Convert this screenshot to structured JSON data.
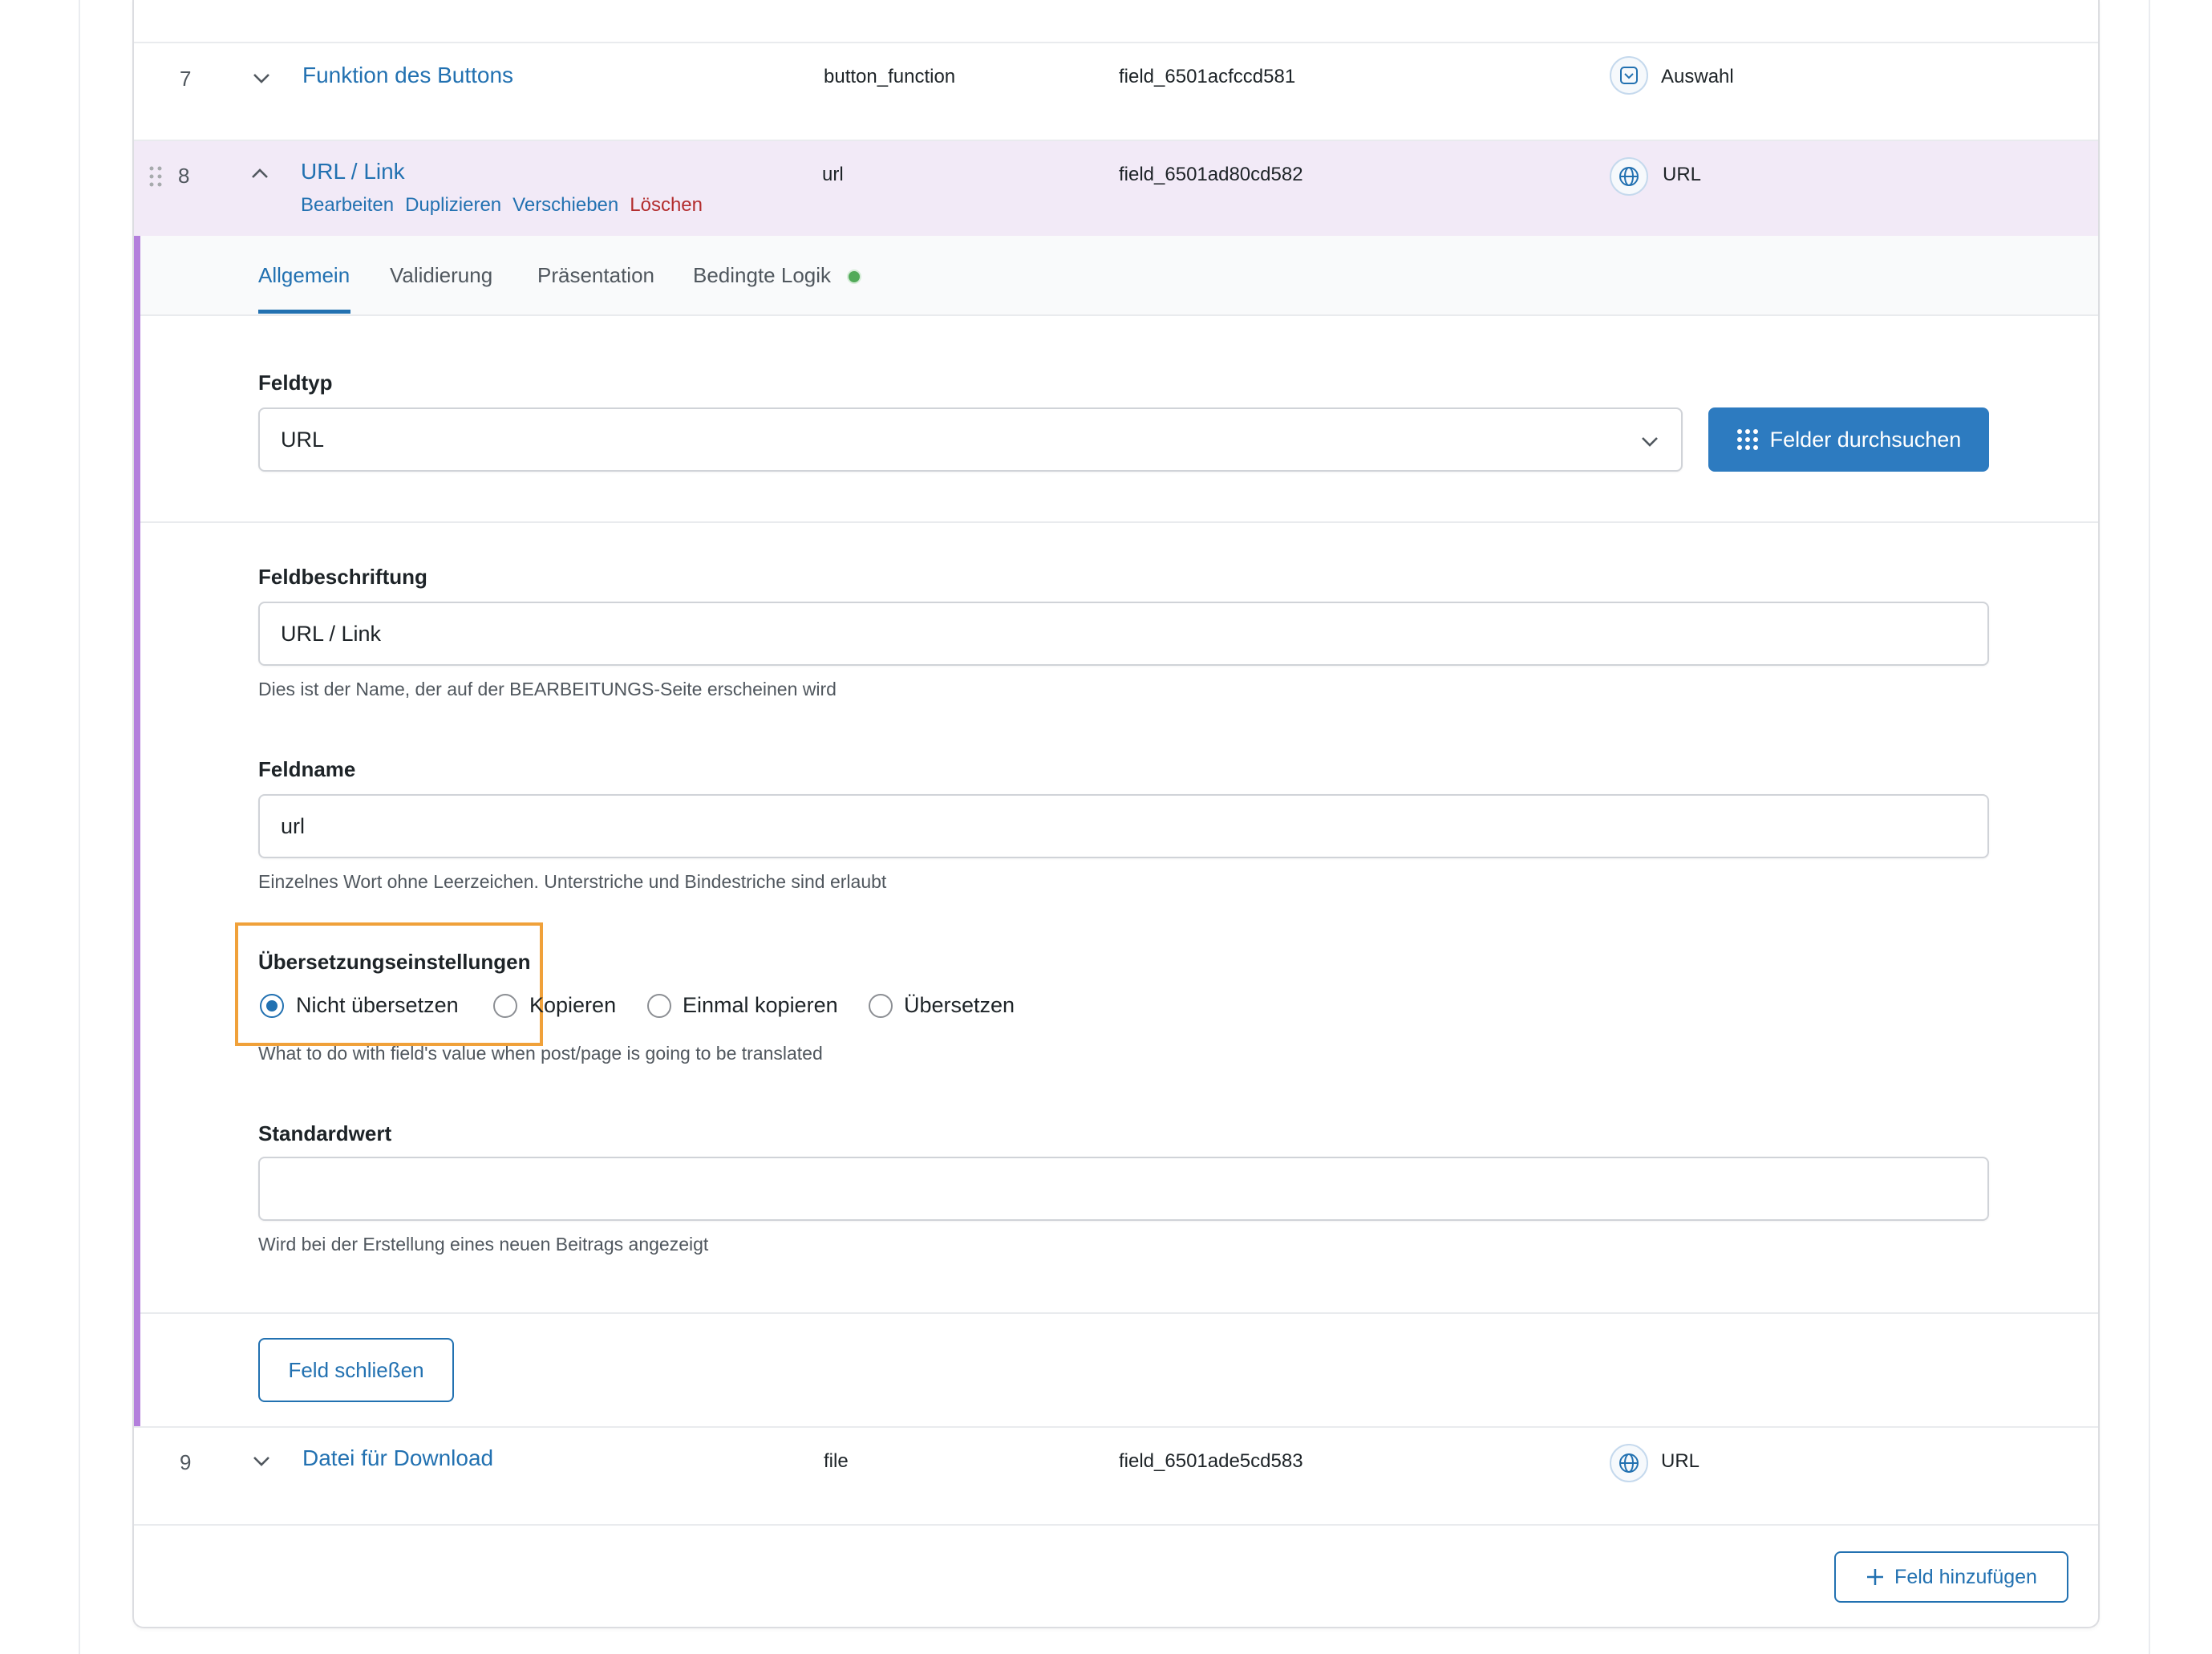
{
  "rows": [
    {
      "num": "7",
      "title": "Funktion des Buttons",
      "name": "button_function",
      "key": "field_6501acfccd581",
      "type": "Auswahl",
      "type_icon": "select-icon"
    },
    {
      "num": "8",
      "title": "URL / Link",
      "name": "url",
      "key": "field_6501ad80cd582",
      "type": "URL",
      "type_icon": "globe-icon"
    },
    {
      "num": "9",
      "title": "Datei für Download",
      "name": "file",
      "key": "field_6501ade5cd583",
      "type": "URL",
      "type_icon": "globe-icon"
    }
  ],
  "row_actions": {
    "edit": "Bearbeiten",
    "duplicate": "Duplizieren",
    "move": "Verschieben",
    "delete": "Löschen"
  },
  "tabs": [
    "Allgemein",
    "Validierung",
    "Präsentation",
    "Bedingte Logik"
  ],
  "field_type": {
    "label": "Feldtyp",
    "value": "URL",
    "browse_button": "Felder durchsuchen"
  },
  "field_label": {
    "label": "Feldbeschriftung",
    "value": "URL / Link",
    "hint": "Dies ist der Name, der auf der BEARBEITUNGS-Seite erscheinen wird"
  },
  "field_name": {
    "label": "Feldname",
    "value": "url",
    "hint": "Einzelnes Wort ohne Leerzeichen. Unterstriche und Bindestriche sind erlaubt"
  },
  "translation": {
    "label": "Übersetzungseinstellungen",
    "options": [
      "Nicht übersetzen",
      "Kopieren",
      "Einmal kopieren",
      "Übersetzen"
    ],
    "selected": "Nicht übersetzen",
    "hint": "What to do with field's value when post/page is going to be translated"
  },
  "default_value": {
    "label": "Standardwert",
    "value": "",
    "hint": "Wird bei der Erstellung eines neuen Beitrags angezeigt"
  },
  "close_button": "Feld schließen",
  "add_button": "Feld hinzufügen",
  "colors": {
    "accent": "#2271b1",
    "delete": "#b32d2e",
    "open_row_bg": "#f2eaf7",
    "open_bar": "#b37fdc",
    "highlight": "#f0a13a",
    "status_dot": "#52aa59"
  }
}
